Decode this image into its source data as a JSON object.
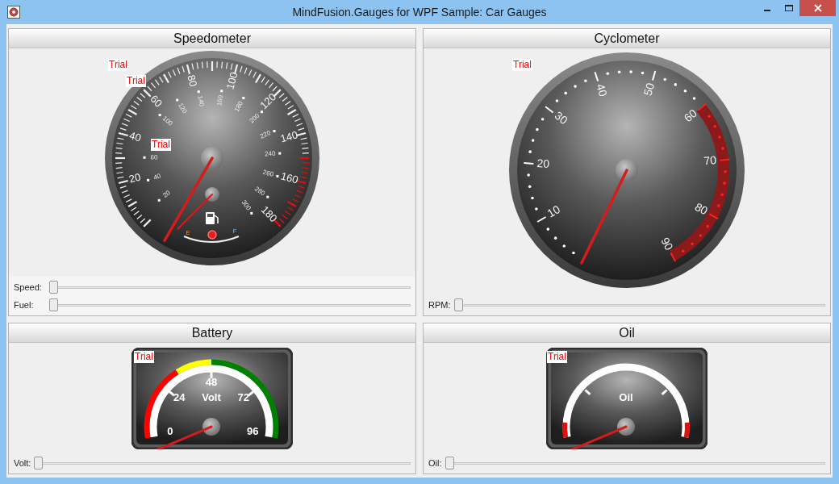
{
  "window": {
    "title": "MindFusion.Gauges for WPF Sample: Car Gauges"
  },
  "panels": [
    {
      "kind": "speedometer",
      "title": "Speedometer",
      "trial_badges": [
        "Trial",
        "Trial",
        "Trial"
      ],
      "outer_labels": [
        "20",
        "40",
        "60",
        "80",
        "100",
        "120",
        "140",
        "160",
        "180"
      ],
      "inner_labels": [
        "20",
        "40",
        "60",
        "100",
        "120",
        "140",
        "160",
        "180",
        "200",
        "220",
        "240",
        "260",
        "280",
        "300"
      ],
      "fuel_labels": [
        "E",
        "F"
      ],
      "sliders": [
        {
          "label": "Speed:",
          "level": 0
        },
        {
          "label": "Fuel:",
          "level": 0
        }
      ]
    },
    {
      "kind": "cyclometer",
      "title": "Cyclometer",
      "trial_badges": [
        "Trial"
      ],
      "labels": [
        "10",
        "20",
        "30",
        "40",
        "50",
        "60",
        "70",
        "80",
        "90"
      ],
      "sliders": [
        {
          "label": "RPM:",
          "level": 0
        }
      ]
    },
    {
      "kind": "battery",
      "title": "Battery",
      "trial_badges": [
        "Trial"
      ],
      "labels": [
        "0",
        "24",
        "48",
        "72",
        "96"
      ],
      "unit": "Volt",
      "sliders": [
        {
          "label": "Volt:",
          "level": 0
        }
      ]
    },
    {
      "kind": "oil",
      "title": "Oil",
      "trial_badges": [
        "Trial"
      ],
      "unit": "Oil",
      "sliders": [
        {
          "label": "Oil:",
          "level": 0
        }
      ]
    }
  ]
}
